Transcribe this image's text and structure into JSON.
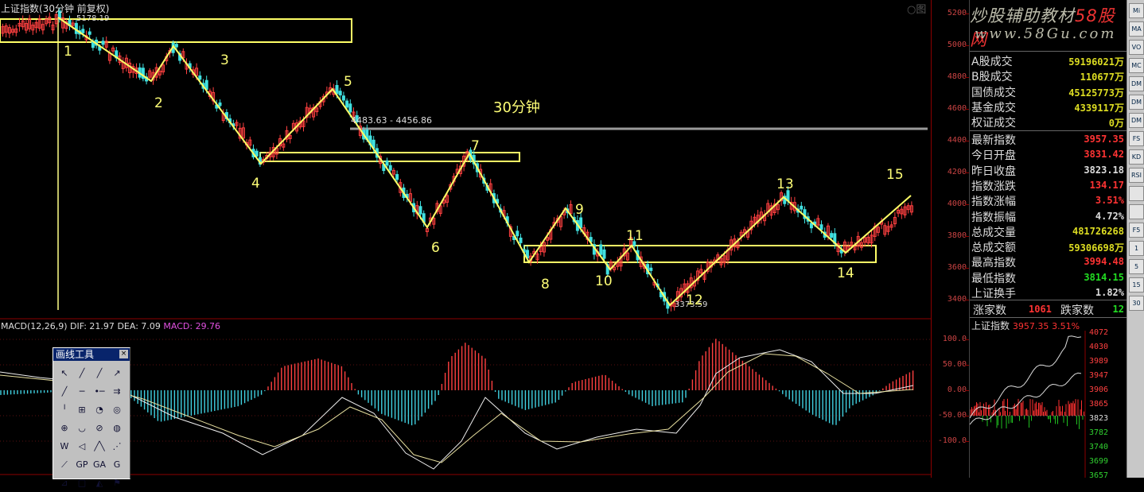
{
  "chart_title": "上证指数(30分钟 前复权)",
  "wave_labels": [
    "1",
    "2",
    "3",
    "4",
    "5",
    "6",
    "7",
    "8",
    "9",
    "10",
    "11",
    "12",
    "13",
    "14",
    "15"
  ],
  "period_label": "30分钟",
  "range_label": "4483.63 - 4456.86",
  "high_marker": "5178.19",
  "low_marker": "3373.59",
  "macd": {
    "name": "MACD(12,26,9)",
    "dif": "DIF: 21.97",
    "dea": "DEA: 7.09",
    "macd": "MACD: 29.76",
    "axis_labels": [
      "100.0",
      "50.00",
      "0.00",
      "-50.00",
      "-100.0"
    ]
  },
  "price_axis_labels": [
    "5200",
    "5000",
    "4800",
    "4600",
    "4400",
    "4200",
    "4000",
    "3800",
    "3600",
    "3400"
  ],
  "corner_text": "○图",
  "draw_tools": {
    "title": "画线工具",
    "close": "×",
    "icons": [
      "cursor-icon",
      "line-icon",
      "ray-icon",
      "arrow-line-icon",
      "segment-icon",
      "horizontal-line-icon",
      "price-line-icon",
      "parallel-icon",
      "vertical-line-icon",
      "fibonacci-icon",
      "gann-icon",
      "text-icon",
      "spiral-icon",
      "arc-icon",
      "circle-icon",
      "cycle-icon",
      "w-pattern-icon",
      "bracket-icon",
      "wave-icon",
      "fan-icon",
      "triangle-icon",
      "gp-icon",
      "ga-icon",
      "gc-icon",
      "wedge-icon",
      "square-icon",
      "polygon-icon",
      "flag-icon"
    ],
    "glyphs": [
      "↖",
      "╱",
      "╱",
      "↗",
      "╱",
      "─",
      "•─",
      "⇉",
      "╵",
      "⊞",
      "◔",
      "◎",
      "⊕",
      "◡",
      "⊘",
      "◍",
      "W",
      "◁",
      "╱╲",
      "⋰",
      "⟋",
      "GP",
      "GA",
      "G",
      "⊿",
      "□",
      "◭",
      "⚑"
    ]
  },
  "brand": {
    "line1_a": "炒股辅助教材",
    "line1_b": "58股网",
    "line2": "www.58Gu.com"
  },
  "market_stats": [
    {
      "label": "A股成交",
      "value": "59196021万",
      "color": "#dddd22"
    },
    {
      "label": "B股成交",
      "value": "110677万",
      "color": "#dddd22"
    },
    {
      "label": "国债成交",
      "value": "45125773万",
      "color": "#dddd22"
    },
    {
      "label": "基金成交",
      "value": "4339117万",
      "color": "#dddd22"
    },
    {
      "label": "权证成交",
      "value": "0万",
      "color": "#dddd22"
    }
  ],
  "index_stats": [
    {
      "label": "最新指数",
      "value": "3957.35",
      "color": "#ff3333"
    },
    {
      "label": "今日开盘",
      "value": "3831.42",
      "color": "#ff3333"
    },
    {
      "label": "昨日收盘",
      "value": "3823.18",
      "color": "#dddddd"
    },
    {
      "label": "指数涨跌",
      "value": "134.17",
      "color": "#ff3333"
    },
    {
      "label": "指数涨幅",
      "value": "3.51%",
      "color": "#ff3333"
    },
    {
      "label": "指数振幅",
      "value": "4.72%",
      "color": "#dddddd"
    },
    {
      "label": "总成交量",
      "value": "481726268",
      "color": "#dddd22"
    },
    {
      "label": "总成交额",
      "value": "59306698万",
      "color": "#dddd22"
    },
    {
      "label": "最高指数",
      "value": "3994.48",
      "color": "#ff3333"
    },
    {
      "label": "最低指数",
      "value": "3814.15",
      "color": "#22dd22"
    },
    {
      "label": "上证换手",
      "value": "1.82%",
      "color": "#dddddd"
    }
  ],
  "advance_decline": {
    "up_label": "涨家数",
    "up": "1061",
    "down_label": "跌家数",
    "down": "12"
  },
  "mini_chart": {
    "title": "上证指数",
    "value": "3957.35",
    "change": "3.51%",
    "axis": [
      "4072",
      "4030",
      "3989",
      "3947",
      "3906",
      "3865",
      "3823",
      "3782",
      "3740",
      "3699",
      "3657"
    ]
  },
  "toolbar": [
    "Mi",
    "MA",
    "VO",
    "MC",
    "DM",
    "DM",
    "DM",
    "FS",
    "KD",
    "RSI",
    "",
    "",
    "F5",
    "1",
    "5",
    "15",
    "30"
  ]
}
